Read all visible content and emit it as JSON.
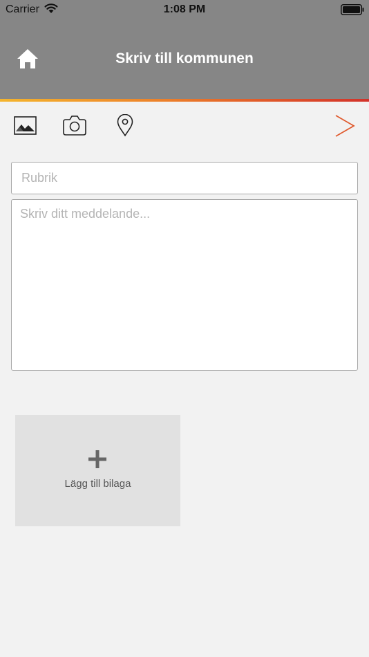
{
  "status_bar": {
    "carrier": "Carrier",
    "time": "1:08 PM",
    "wifi_icon": "wifi-icon",
    "battery_icon": "battery-icon"
  },
  "nav": {
    "title": "Skriv till kommunen",
    "home_icon": "home-icon"
  },
  "colors": {
    "header_bg": "#868686",
    "accent_gradient": [
      "#f5b52d",
      "#ec7f2a",
      "#d3322a"
    ],
    "send_accent": "#e05a2e",
    "page_bg": "#f2f2f2",
    "attachment_bg": "#e1e1e1"
  },
  "toolbar": {
    "icons": [
      "image-icon",
      "camera-icon",
      "location-icon",
      "send-icon"
    ]
  },
  "form": {
    "subject_placeholder": "Rubrik",
    "subject_value": "",
    "message_placeholder": "Skriv ditt meddelande...",
    "message_value": ""
  },
  "attachment": {
    "icon": "plus-icon",
    "label": "Lägg till bilaga"
  }
}
